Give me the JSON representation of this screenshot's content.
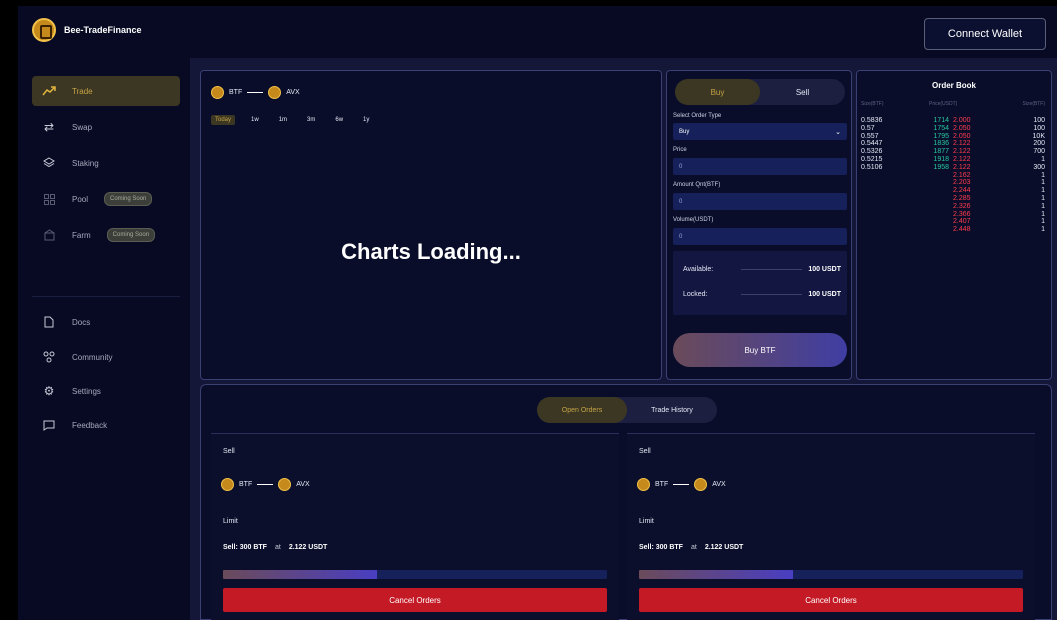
{
  "header": {
    "brand": "Bee-TradeFinance",
    "connect_label": "Connect Wallet"
  },
  "sidebar": {
    "items": [
      {
        "label": "Trade",
        "icon": "trend-icon",
        "active": true
      },
      {
        "label": "Swap",
        "icon": "swap-icon"
      },
      {
        "label": "Staking",
        "icon": "layers-icon"
      },
      {
        "label": "Pool",
        "icon": "grid-icon",
        "badge": "Coming Soon"
      },
      {
        "label": "Farm",
        "icon": "farm-icon",
        "badge": "Coming Soon"
      }
    ],
    "secondary": [
      {
        "label": "Docs",
        "icon": "doc-icon"
      },
      {
        "label": "Community",
        "icon": "community-icon"
      },
      {
        "label": "Settings",
        "icon": "gear-icon"
      },
      {
        "label": "Feedback",
        "icon": "chat-icon"
      }
    ]
  },
  "chart": {
    "base": "BTF",
    "quote": "AVX",
    "ranges": [
      "Today",
      "1w",
      "1m",
      "3m",
      "6w",
      "1y"
    ],
    "active_range": "Today",
    "loading_text": "Charts Loading..."
  },
  "order_form": {
    "buy_label": "Buy",
    "sell_label": "Sell",
    "order_type_label": "Select Order Type",
    "order_type_value": "Buy",
    "price_label": "Price",
    "price_value": "0",
    "amount_label": "Amount Qnt(BTF)",
    "amount_value": "0",
    "volume_label": "Volume(USDT)",
    "volume_value": "0",
    "available_label": "Available:",
    "available_value": "100 USDT",
    "locked_label": "Locked:",
    "locked_value": "100 USDT",
    "submit_label": "Buy BTF"
  },
  "order_book": {
    "title": "Order Book",
    "headers": [
      "Size(BTF)",
      "Price(USDT)",
      "Size(BTF)"
    ],
    "sizes": [
      "0.5836",
      "0.57",
      "0.557",
      "0.5447",
      "0.5326",
      "0.5215",
      "0.5106"
    ],
    "buy_prices": [
      "1714",
      "1754",
      "1795",
      "1836",
      "1877",
      "1918",
      "1958"
    ],
    "sell_prices": [
      "2.000",
      "2.050",
      "2.050",
      "2.122",
      "2.122",
      "2.122",
      "2.122",
      "2.162",
      "2.203",
      "2.244",
      "2.285",
      "2.326",
      "2.366",
      "2.407",
      "2.448"
    ],
    "amounts": [
      "100",
      "100",
      "10K",
      "200",
      "700",
      "1",
      "300",
      "1",
      "1",
      "1",
      "1",
      "1",
      "1",
      "1",
      "1"
    ]
  },
  "history": {
    "tab_open": "Open Orders",
    "tab_history": "Trade History",
    "orders": [
      {
        "side": "Sell",
        "base": "BTF",
        "quote": "AVX",
        "type": "Limit",
        "summary": "Sell: 300 BTF",
        "at": "at",
        "price": "2.122 USDT",
        "progress": 0.4,
        "cancel": "Cancel Orders"
      },
      {
        "side": "Sell",
        "base": "BTF",
        "quote": "AVX",
        "type": "Limit",
        "summary": "Sell: 300 BTF",
        "at": "at",
        "price": "2.122 USDT",
        "progress": 0.4,
        "cancel": "Cancel Orders"
      }
    ]
  }
}
